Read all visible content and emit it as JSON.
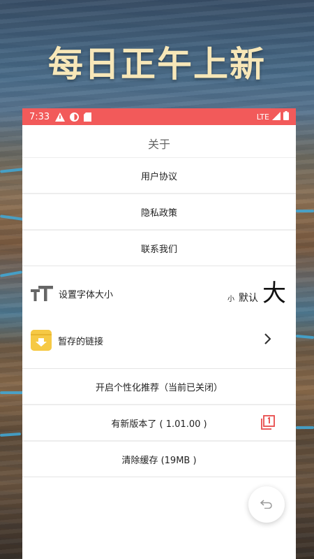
{
  "banner": {
    "text": "每日正午上新"
  },
  "status_bar": {
    "time": "7:33",
    "network": "LTE"
  },
  "page": {
    "title": "关于"
  },
  "menu": {
    "user_agreement": "用户协议",
    "privacy_policy": "隐私政策",
    "contact_us": "联系我们",
    "personalized_recommend": "开启个性化推荐（当前已关闭）",
    "new_version": "有新版本了 ( 1.01.00 )",
    "clear_cache": "清除缓存 (19MB )"
  },
  "font_setting": {
    "label": "设置字体大小",
    "small": "小",
    "default": "默认",
    "large": "大"
  },
  "saved_links": {
    "label": "暂存的链接"
  },
  "update_badge": {
    "count": "1"
  },
  "colors": {
    "status_bar": "#f25a5a",
    "banner_text": "#f7e7b8",
    "folder_icon": "#f6c945",
    "update_icon": "#e84a4a"
  },
  "icons": {
    "font_size": "text-size-icon",
    "saved_links": "archive-box-icon",
    "chevron": "chevron-right-icon",
    "update": "copy-badge-icon",
    "fab": "back-arrow-icon"
  }
}
